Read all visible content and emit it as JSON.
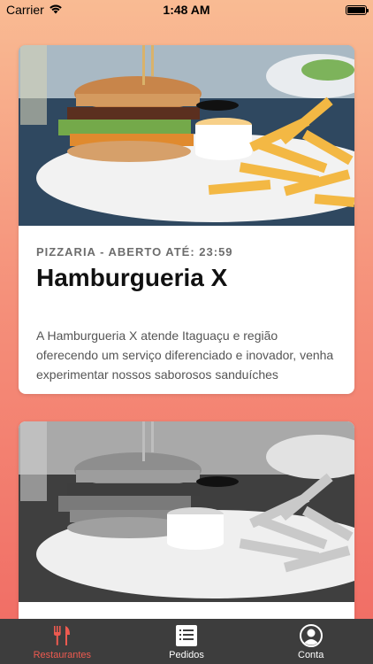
{
  "status_bar": {
    "carrier": "Carrier",
    "time": "1:48 AM",
    "wifi_icon": "wifi-icon",
    "battery_icon": "battery-icon"
  },
  "restaurants": [
    {
      "subtitle": "PIZZARIA - ABERTO ATÉ: 23:59",
      "name": "Hamburgueria X",
      "description": "A Hamburgueria X atende Itaguaçu e região oferecendo um serviço diferenciado e inovador, venha experimentar nossos saborosos sanduíches",
      "image": "burger-and-fries-photo"
    },
    {
      "image": "burger-and-fries-photo-grayscale"
    }
  ],
  "tab_bar": {
    "tabs": [
      {
        "label": "Restaurantes",
        "icon": "fork-knife-icon",
        "active": true
      },
      {
        "label": "Pedidos",
        "icon": "list-icon",
        "active": false
      },
      {
        "label": "Conta",
        "icon": "user-icon",
        "active": false
      }
    ],
    "active_color": "#ee5a50"
  }
}
